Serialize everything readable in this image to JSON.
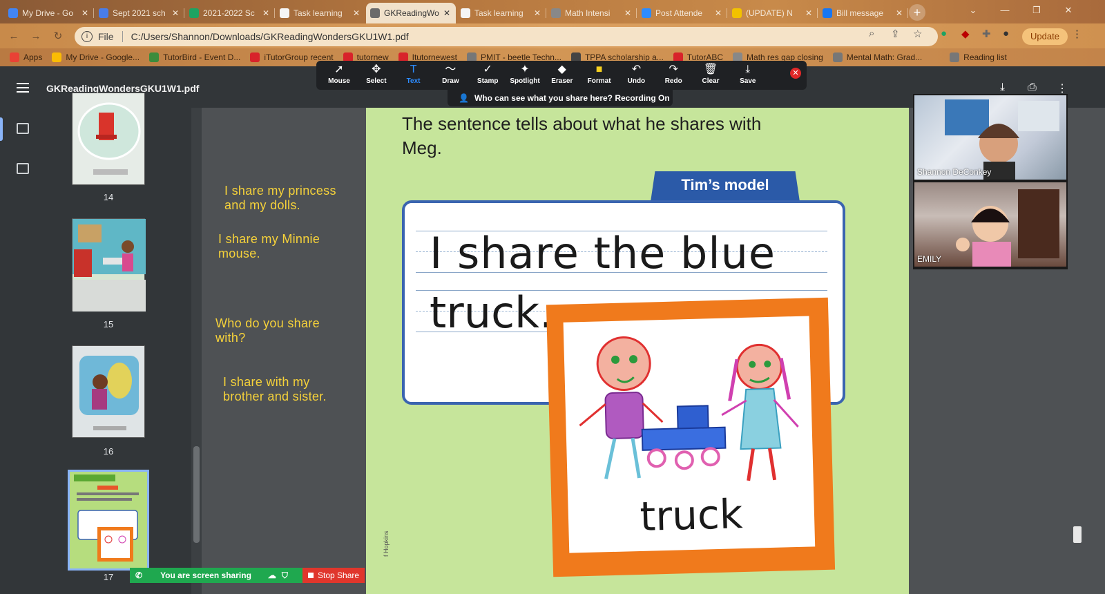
{
  "browser": {
    "tabs": [
      {
        "title": "My Drive - Go",
        "color": "#4285f4"
      },
      {
        "title": "Sept 2021 sch",
        "color": "#4a7de8"
      },
      {
        "title": "2021-2022 Sc",
        "color": "#1ea362"
      },
      {
        "title": "Task learning",
        "color": "#f5f5f5"
      },
      {
        "title": "GKReadingWo",
        "color": "#6b6b6b"
      },
      {
        "title": "Task learning",
        "color": "#f5f5f5"
      },
      {
        "title": "Math Intensi",
        "color": "#888888"
      },
      {
        "title": "Post Attende",
        "color": "#2d8cff"
      },
      {
        "title": "(UPDATE) N",
        "color": "#f2c200"
      },
      {
        "title": "Bill message",
        "color": "#1877f2"
      }
    ],
    "new_tab": "+",
    "address": {
      "scheme": "File",
      "url": "C:/Users/Shannon/Downloads/GKReadingWondersGKU1W1.pdf"
    },
    "update_label": "Update",
    "bookmarks": [
      {
        "label": "Apps",
        "color": "#e94235"
      },
      {
        "label": "My Drive - Google...",
        "color": "#fbbc04"
      },
      {
        "label": "TutorBird - Event D...",
        "color": "#3c8c3c"
      },
      {
        "label": "iTutorGroup recent",
        "color": "#d8232a"
      },
      {
        "label": "tutornew",
        "color": "#d8232a"
      },
      {
        "label": "Itutornewest",
        "color": "#d8232a"
      },
      {
        "label": "PMIT - beetle Techn...",
        "color": "#777777"
      },
      {
        "label": "TPPA scholarship a...",
        "color": "#444444"
      },
      {
        "label": "TutorABC",
        "color": "#d8232a"
      },
      {
        "label": "Math res gap closing",
        "color": "#888888"
      },
      {
        "label": "Mental Math: Grad...",
        "color": "#777777"
      },
      {
        "label": "Reading list",
        "color": "#777777"
      }
    ]
  },
  "pdf": {
    "title": "GKReadingWondersGKU1W1.pdf",
    "pages": [
      "14",
      "15",
      "16",
      "17"
    ]
  },
  "zoom": {
    "tools": [
      {
        "label": "Mouse",
        "icon": "➚"
      },
      {
        "label": "Select",
        "icon": "✥"
      },
      {
        "label": "Text",
        "icon": "T"
      },
      {
        "label": "Draw",
        "icon": "〜"
      },
      {
        "label": "Stamp",
        "icon": "✓"
      },
      {
        "label": "Spotlight",
        "icon": "✦"
      },
      {
        "label": "Eraser",
        "icon": "◆"
      },
      {
        "label": "Format",
        "icon": "■"
      },
      {
        "label": "Undo",
        "icon": "↶"
      },
      {
        "label": "Redo",
        "icon": "↷"
      },
      {
        "label": "Clear",
        "icon": "🗑"
      },
      {
        "label": "Save",
        "icon": "⤓"
      }
    ],
    "who_can_see": "Who can see what you share here? Recording On",
    "sharing_label": "You are screen sharing",
    "stop_share_label": "Stop Share",
    "participants": [
      {
        "name": "Shannon DeConkey"
      },
      {
        "name": "EMILY"
      }
    ]
  },
  "notes": [
    "I share my princess and my dolls.",
    "I share my Minnie mouse.",
    "Who do you share with?",
    "I share with my brother and sister."
  ],
  "page": {
    "sentence": "The sentence tells about what he shares with Meg.",
    "model_title": "Tim’s model",
    "handwriting_line1": "I share the blue",
    "handwriting_line2": "truck.",
    "picture_label": "truck",
    "copyright": "f Hopkins"
  }
}
